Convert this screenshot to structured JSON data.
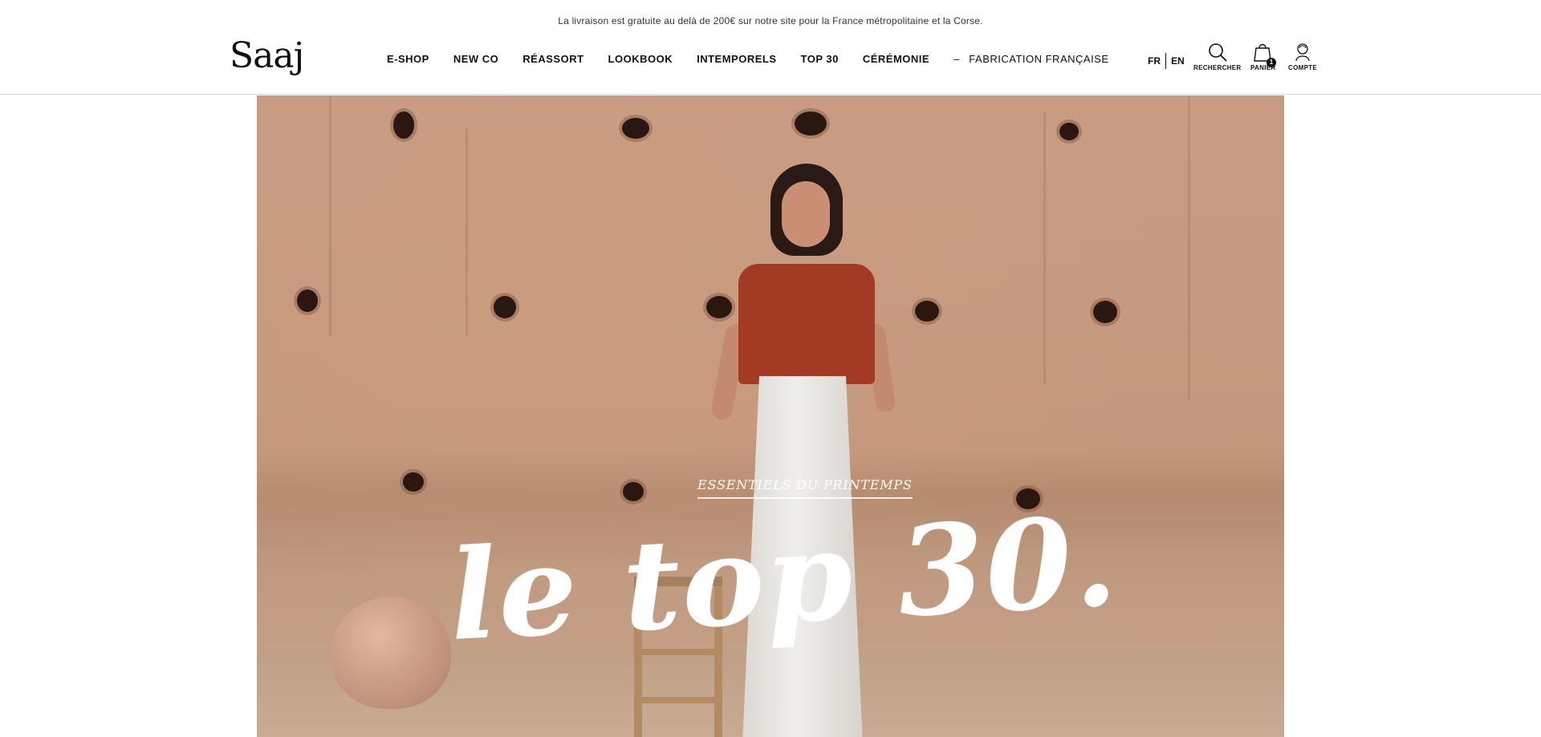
{
  "announcement": "La livraison est gratuite au delà de 200€ sur notre site pour la France métropolitaine et la Corse.",
  "brand": "Saaj",
  "nav": [
    {
      "label": "E-SHOP"
    },
    {
      "label": "NEW CO"
    },
    {
      "label": "RÉASSORT"
    },
    {
      "label": "LOOKBOOK"
    },
    {
      "label": "INTEMPORELS"
    },
    {
      "label": "TOP 30"
    },
    {
      "label": "CÉRÉMONIE"
    }
  ],
  "nav_secondary": {
    "dash": "–",
    "label": "FABRICATION FRANÇAISE"
  },
  "languages": {
    "current": "FR",
    "other": "EN"
  },
  "utilities": {
    "search": {
      "label": "RECHERCHER",
      "icon": "search-icon"
    },
    "cart": {
      "label": "PANIER",
      "count": "1",
      "icon": "shopping-bag-icon"
    },
    "account": {
      "label": "COMPTE",
      "icon": "user-icon"
    }
  },
  "hero": {
    "kicker": "ESSENTIELS DU PRINTEMPS",
    "headline": "le top 30."
  },
  "colors": {
    "text": "#111111",
    "wall": "#c79c83",
    "shirt": "#a33a24",
    "headline": "#ffffff"
  }
}
